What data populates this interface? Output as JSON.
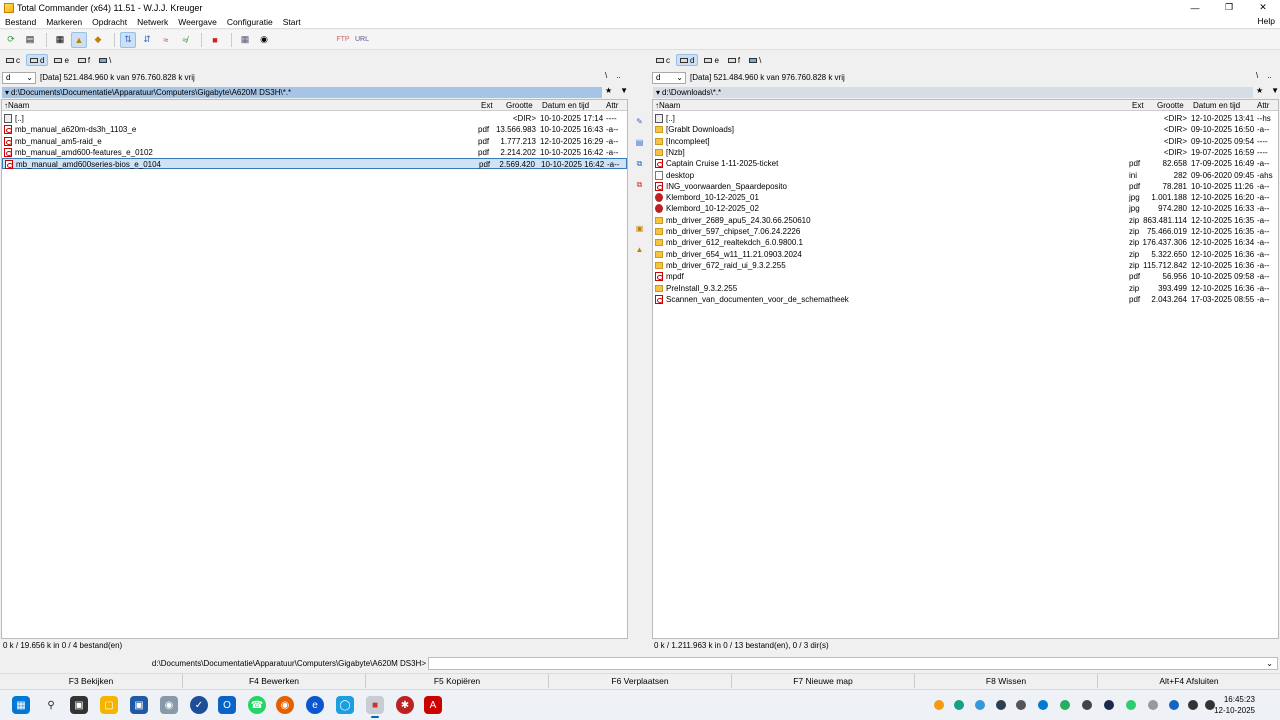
{
  "window": {
    "title": "Total Commander (x64) 11.51 - W.J.J. Kreuger"
  },
  "menu": [
    "Bestand",
    "Markeren",
    "Opdracht",
    "Netwerk",
    "Weergave",
    "Configuratie",
    "Start"
  ],
  "menu_help": "Help",
  "drives": [
    "c",
    "d",
    "e",
    "f",
    "\\"
  ],
  "left": {
    "drive": "d",
    "info": "[Data]  521.484.960 k van 976.760.828 k vrij",
    "path": "d:\\Documents\\Documentatie\\Apparatuur\\Computers\\Gigabyte\\A620M DS3H\\*.*",
    "status": "0 k / 19.656 k in 0 / 4 bestand(en)",
    "rows": [
      {
        "name": "[..]",
        "ext": "",
        "size": "<DIR>",
        "date": "10-10-2025 17:14",
        "attr": "----",
        "icon": "up"
      },
      {
        "name": "mb_manual_a620m-ds3h_1103_e",
        "ext": "pdf",
        "size": "13.566.983",
        "date": "10-10-2025 16:43",
        "attr": "-a--",
        "icon": "pdf"
      },
      {
        "name": "mb_manual_am5-raid_e",
        "ext": "pdf",
        "size": "1.777.213",
        "date": "12-10-2025 16:29",
        "attr": "-a--",
        "icon": "pdf"
      },
      {
        "name": "mb_manual_amd600-features_e_0102",
        "ext": "pdf",
        "size": "2.214.202",
        "date": "10-10-2025 16:42",
        "attr": "-a--",
        "icon": "pdf"
      },
      {
        "name": "mb_manual_amd600series-bios_e_0104",
        "ext": "pdf",
        "size": "2.569.420",
        "date": "10-10-2025 16:42",
        "attr": "-a--",
        "icon": "pdf"
      }
    ]
  },
  "right": {
    "drive": "d",
    "info": "[Data]  521.484.960 k van 976.760.828 k vrij",
    "path": "d:\\Downloads\\*.*",
    "status": "0 k / 1.211.963 k in 0 / 13 bestand(en), 0 / 3 dir(s)",
    "rows": [
      {
        "name": "[..]",
        "ext": "",
        "size": "<DIR>",
        "date": "12-10-2025 13:41",
        "attr": "--hs",
        "icon": "up"
      },
      {
        "name": "[Grablt Downloads]",
        "ext": "",
        "size": "<DIR>",
        "date": "09-10-2025 16:50",
        "attr": "-a--",
        "icon": "folder"
      },
      {
        "name": "[Incompleet]",
        "ext": "",
        "size": "<DIR>",
        "date": "09-10-2025 09:54",
        "attr": "----",
        "icon": "folder"
      },
      {
        "name": "[Nzb]",
        "ext": "",
        "size": "<DIR>",
        "date": "19-07-2025 16:59",
        "attr": "----",
        "icon": "folder"
      },
      {
        "name": "Captain Cruise 1-11-2025-ticket",
        "ext": "pdf",
        "size": "82.658",
        "date": "17-09-2025 16:49",
        "attr": "-a--",
        "icon": "pdf"
      },
      {
        "name": "desktop",
        "ext": "ini",
        "size": "282",
        "date": "09-06-2020 09:45",
        "attr": "-ahs",
        "icon": "gen"
      },
      {
        "name": "ING_voorwaarden_Spaardeposito",
        "ext": "pdf",
        "size": "78.281",
        "date": "10-10-2025 11:26",
        "attr": "-a--",
        "icon": "pdf"
      },
      {
        "name": "Klembord_10-12-2025_01",
        "ext": "jpg",
        "size": "1.001.188",
        "date": "12-10-2025 16:20",
        "attr": "-a--",
        "icon": "jpg"
      },
      {
        "name": "Klembord_10-12-2025_02",
        "ext": "jpg",
        "size": "974.280",
        "date": "12-10-2025 16:33",
        "attr": "-a--",
        "icon": "jpg"
      },
      {
        "name": "mb_driver_2689_apu5_24.30.66.250610",
        "ext": "zip",
        "size": "863.481.114",
        "date": "12-10-2025 16:35",
        "attr": "-a--",
        "icon": "zip"
      },
      {
        "name": "mb_driver_597_chipset_7.06.24.2226",
        "ext": "zip",
        "size": "75.466.019",
        "date": "12-10-2025 16:35",
        "attr": "-a--",
        "icon": "zip"
      },
      {
        "name": "mb_driver_612_realtekdch_6.0.9800.1",
        "ext": "zip",
        "size": "176.437.306",
        "date": "12-10-2025 16:34",
        "attr": "-a--",
        "icon": "zip"
      },
      {
        "name": "mb_driver_654_w11_11.21.0903.2024",
        "ext": "zip",
        "size": "5.322.650",
        "date": "12-10-2025 16:36",
        "attr": "-a--",
        "icon": "zip"
      },
      {
        "name": "mb_driver_672_raid_ui_9.3.2.255",
        "ext": "zip",
        "size": "115.712.842",
        "date": "12-10-2025 16:36",
        "attr": "-a--",
        "icon": "zip"
      },
      {
        "name": "mpdf",
        "ext": "pdf",
        "size": "56.956",
        "date": "10-10-2025 09:58",
        "attr": "-a--",
        "icon": "pdf"
      },
      {
        "name": "PreInstall_9.3.2.255",
        "ext": "zip",
        "size": "393.499",
        "date": "12-10-2025 16:36",
        "attr": "-a--",
        "icon": "zip"
      },
      {
        "name": "Scannen_van_documenten_voor_de_schematheek",
        "ext": "pdf",
        "size": "2.043.264",
        "date": "17-03-2025 08:55",
        "attr": "-a--",
        "icon": "pdf"
      }
    ]
  },
  "columns": {
    "name": "Naam",
    "ext": "Ext",
    "size": "Grootte",
    "date": "Datum en tijd",
    "attr": "Attr"
  },
  "cmdline_path": "d:\\Documents\\Documentatie\\Apparatuur\\Computers\\Gigabyte\\A620M DS3H>",
  "fkeys": [
    "F3 Bekijken",
    "F4 Bewerken",
    "F5 Kopiëren",
    "F6 Verplaatsen",
    "F7 Nieuwe map",
    "F8 Wissen",
    "Alt+F4 Afsluiten"
  ],
  "clock": {
    "time": "16:45:23",
    "date": "12-10-2025"
  },
  "colors": {
    "path_active": "#a6c5e6",
    "cursor": "#cfe3f7",
    "pdf": "#cc0000",
    "folder": "#f5c542"
  }
}
